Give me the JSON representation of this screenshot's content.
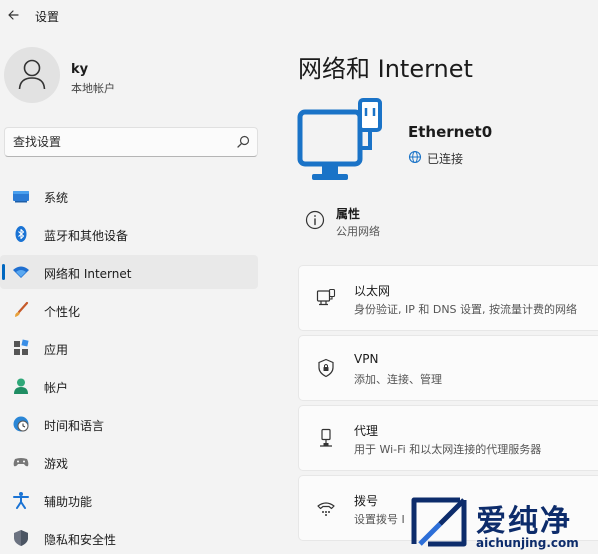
{
  "window": {
    "title": "设置"
  },
  "user": {
    "name": "ky",
    "account_type": "本地帐户"
  },
  "search": {
    "placeholder": "查找设置"
  },
  "sidebar": {
    "items": [
      {
        "label": "系统",
        "icon": "system-icon"
      },
      {
        "label": "蓝牙和其他设备",
        "icon": "bluetooth-icon"
      },
      {
        "label": "网络和 Internet",
        "icon": "wifi-icon",
        "selected": true
      },
      {
        "label": "个性化",
        "icon": "brush-icon"
      },
      {
        "label": "应用",
        "icon": "apps-icon"
      },
      {
        "label": "帐户",
        "icon": "person-icon"
      },
      {
        "label": "时间和语言",
        "icon": "globe-clock-icon"
      },
      {
        "label": "游戏",
        "icon": "gamepad-icon"
      },
      {
        "label": "辅助功能",
        "icon": "accessibility-icon"
      },
      {
        "label": "隐私和安全性",
        "icon": "shield-icon"
      }
    ]
  },
  "main": {
    "title": "网络和 Internet",
    "connection": {
      "name": "Ethernet0",
      "status": "已连接"
    },
    "properties": {
      "title": "属性",
      "subtitle": "公用网络"
    },
    "cards": [
      {
        "title": "以太网",
        "subtitle": "身份验证, IP 和 DNS 设置, 按流量计费的网络",
        "icon": "ethernet-icon"
      },
      {
        "title": "VPN",
        "subtitle": "添加、连接、管理",
        "icon": "vpn-shield-icon"
      },
      {
        "title": "代理",
        "subtitle": "用于 Wi-Fi 和以太网连接的代理服务器",
        "icon": "proxy-icon"
      },
      {
        "title": "拨号",
        "subtitle": "设置拨号 I",
        "icon": "dialup-icon"
      }
    ]
  },
  "watermark": {
    "text": "爱纯净",
    "url": "aichunjing.com"
  },
  "colors": {
    "accent": "#0067c0",
    "window_bg": "#f3f3f3",
    "card_bg": "#fbfbfb",
    "monitor_blue": "#1a73c7"
  }
}
